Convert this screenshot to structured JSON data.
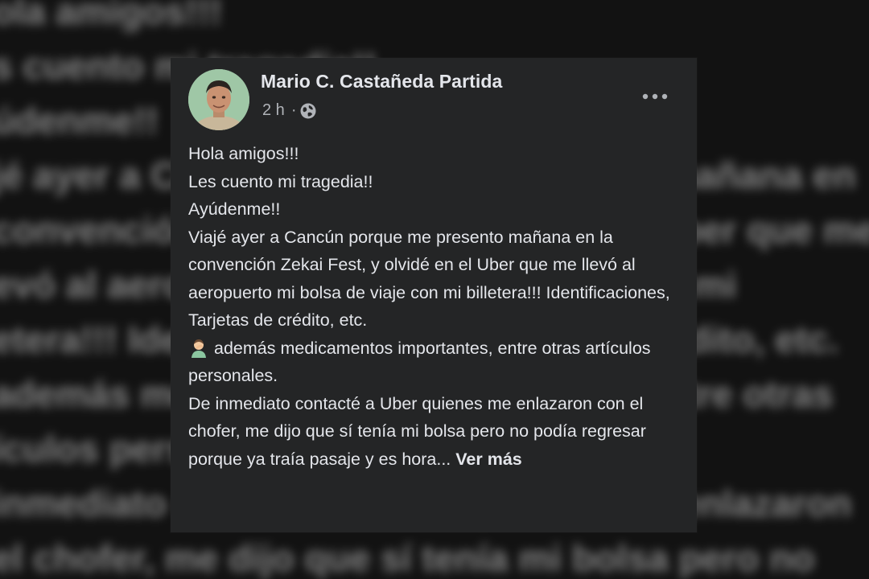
{
  "post": {
    "author": "Mario C. Castañeda Partida",
    "time": "2 h",
    "separator": "·",
    "privacy_icon": "globe-icon",
    "more_icon": "more-options-icon",
    "lines": [
      "Hola amigos!!!",
      "Les cuento mi tragedia!!",
      "Ayúdenme!!"
    ],
    "paragraph_main": "Viajé ayer a Cancún porque me presento mañana en la convención Zekai Fest, y olvidé en el Uber que me llevó al aeropuerto mi bolsa de viaje con mi billetera!!! Identificaciones, Tarjetas de crédito, etc.",
    "emoji_icon": "person-facepalming-icon",
    "paragraph_emoji": "además medicamentos importantes, entre otras artículos personales.",
    "paragraph_last": "De inmediato contacté a Uber quienes me enlazaron con el chofer, me dijo que sí tenía mi bolsa pero no podía regresar porque ya traía pasaje y es hora...",
    "see_more": "Ver más"
  },
  "colors": {
    "card_bg": "#242526",
    "text_primary": "#e4e6eb",
    "text_secondary": "#b0b3b8"
  }
}
